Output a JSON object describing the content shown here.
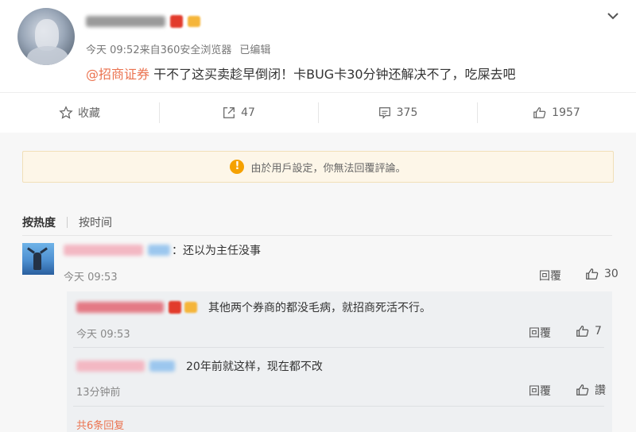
{
  "post": {
    "meta_time": "今天 09:52来自360安全浏览器",
    "meta_edited": "已编辑",
    "mention": "@招商证券",
    "text": " 干不了这买卖趁早倒闭！卡BUG卡30分钟还解决不了，吃屎去吧"
  },
  "actions": {
    "collect": "收藏",
    "repost": "47",
    "comment": "375",
    "like": "1957"
  },
  "notice": "由於用戶設定，你無法回覆評論。",
  "sort": {
    "hot": "按热度",
    "time": "按时间"
  },
  "comments": [
    {
      "text": "：还以为主任没事",
      "time": "今天 09:53",
      "reply": "回覆",
      "likes": "30"
    }
  ],
  "replies": [
    {
      "text": "其他两个券商的都没毛病，就招商死活不行。",
      "time": "今天 09:53",
      "reply": "回覆",
      "likes": "7"
    },
    {
      "text": "20年前就这样，现在都不改",
      "time": "13分钟前",
      "reply": "回覆",
      "likes": "讚"
    }
  ],
  "more_replies": "共6条回复",
  "colors": {
    "accent": "#eb7350",
    "notice_bg": "#fdf6e8",
    "warn": "#f5a100"
  },
  "icons": [
    "chevron-down-icon",
    "star-icon",
    "share-icon",
    "comment-icon",
    "thumbs-up-icon",
    "warning-icon"
  ]
}
